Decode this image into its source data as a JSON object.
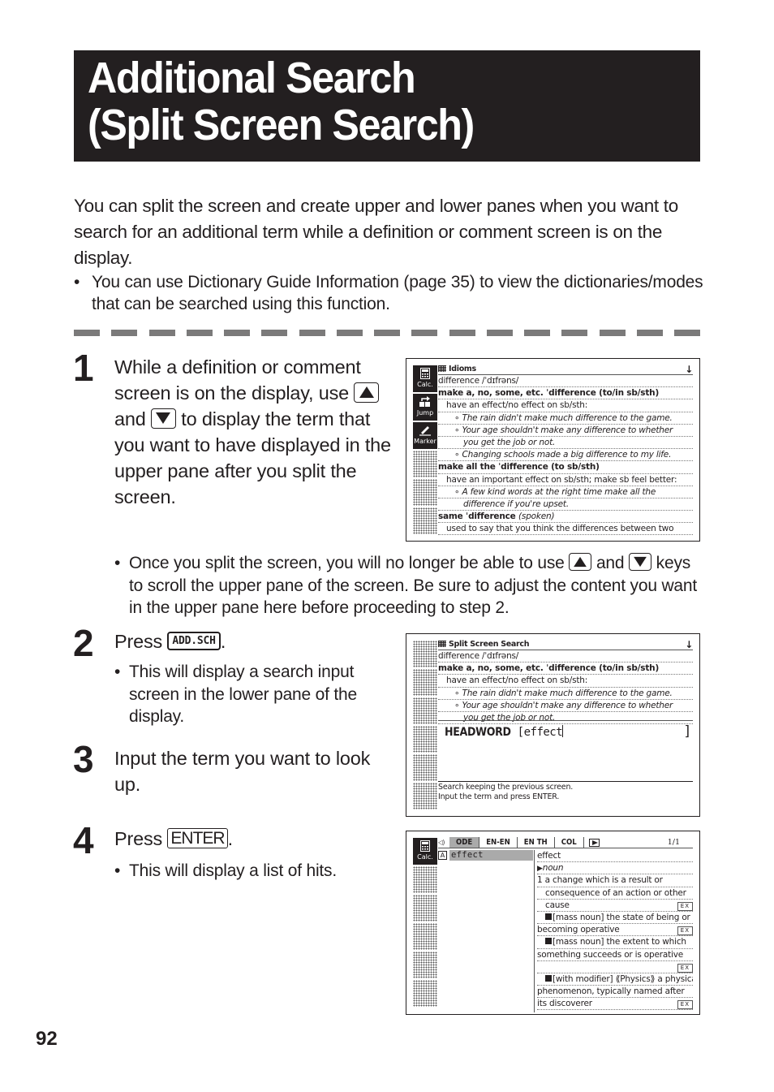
{
  "header": {
    "title_line1": "Additional Search",
    "title_line2": "(Split Screen Search)"
  },
  "intro": {
    "text": "You can split the screen and create upper and lower panes when you want to search for an additional term while a definition or comment screen is on the display.",
    "note": "You can use Dictionary Guide Information (page 35) to view the dictionaries/modes that can be searched using this function."
  },
  "steps": [
    {
      "number": "1",
      "text_part1": "While a definition or comment screen is on the display, use",
      "key_up": "up-arrow-key",
      "and": "and",
      "key_down": "down-arrow-key",
      "text_part2": "to display the term that you want to have displayed in the upper pane after you split the screen.",
      "note_part1": "Once you split the screen, you will no longer be able to use",
      "note_and": "and",
      "note_part2": "keys to scroll the upper pane of the screen. Be sure to adjust the content you want in the upper pane here before proceeding to step 2."
    },
    {
      "number": "2",
      "press": "Press",
      "key": "ADD.SCH",
      "note": "This will display a search input screen in the lower pane of the display."
    },
    {
      "number": "3",
      "text": "Input the term you want to look up."
    },
    {
      "number": "4",
      "press": "Press",
      "key": "ENTER",
      "note": "This will display a list of hits."
    }
  ],
  "screen1": {
    "title": "Idioms",
    "sidebar": [
      "Calc.",
      "Jump",
      "Marker"
    ],
    "rows": [
      {
        "style": "plain",
        "text": "difference /ˈdɪfrəns/"
      },
      {
        "style": "b",
        "text": "make a, no, some, etc. ˈdifference (to/in sb/sth)"
      },
      {
        "style": "i1",
        "text": "have an effect/no effect on sb/sth:"
      },
      {
        "style": "i2",
        "text": "∘ The rain didn't make much difference to the game."
      },
      {
        "style": "i2",
        "text": "∘ Your age shouldn't make any difference to whether"
      },
      {
        "style": "i3",
        "text": "you get the job or not."
      },
      {
        "style": "i2",
        "text": "∘ Changing schools made a big difference to my life."
      },
      {
        "style": "b",
        "text": "make all the ˈdifference (to sb/sth)"
      },
      {
        "style": "i1",
        "text": "have an important effect on sb/sth; make sb feel better:"
      },
      {
        "style": "i2",
        "text": "∘ A few kind words at the right time make all the"
      },
      {
        "style": "i3",
        "text": "difference if you're upset."
      },
      {
        "style": "b",
        "text": "same ˈdifference",
        "suffix": "(spoken)"
      },
      {
        "style": "i1",
        "text": "used to say that you think the differences between two"
      }
    ]
  },
  "screen2": {
    "title": "Split Screen Search",
    "rows": [
      {
        "style": "plain",
        "text": "difference /ˈdɪfrəns/"
      },
      {
        "style": "b",
        "text": "make a, no, some, etc. ˈdifference (to/in sb/sth)"
      },
      {
        "style": "i1",
        "text": "have an effect/no effect on sb/sth:"
      },
      {
        "style": "i2",
        "text": "∘ The rain didn't make much difference to the game."
      },
      {
        "style": "i2",
        "text": "∘ Your age shouldn't make any difference to whether"
      },
      {
        "style": "i3",
        "text": "you get the job or not."
      }
    ],
    "input_label": "HEADWORD",
    "input_value": "effect",
    "guide_line1": "Search keeping the previous screen.",
    "guide_line2": "Input the term and press ENTER."
  },
  "screen3": {
    "sidebar": [
      "Calc."
    ],
    "tabs": [
      {
        "label": "ODE",
        "active": true
      },
      {
        "label": "EN-EN",
        "active": false
      },
      {
        "label": "EN TH",
        "active": false
      },
      {
        "label": "COL",
        "active": false
      }
    ],
    "page_indicator": "1/1",
    "hit_marker": "A",
    "hits": [
      "effect"
    ],
    "definition": [
      {
        "text": "effect"
      },
      {
        "text": "noun",
        "pos": true
      },
      {
        "text": "1 a change which is a result or"
      },
      {
        "text": "consequence of an action or other",
        "indent": true
      },
      {
        "text": "cause",
        "indent": true,
        "ex": "EX"
      },
      {
        "text": "[mass noun] the state of being or",
        "indent": true,
        "square": true
      },
      {
        "text": "becoming operative",
        "ex": "EX"
      },
      {
        "text": "[mass noun] the extent to which",
        "indent": true,
        "square": true
      },
      {
        "text": "something succeeds or is operative"
      },
      {
        "text": "",
        "ex": "EX"
      },
      {
        "text": "[with modifier] ⟪Physics⟫ a physical",
        "indent": true,
        "square": true
      },
      {
        "text": "phenomenon, typically named after"
      },
      {
        "text": "its discoverer",
        "ex": "EX"
      }
    ]
  },
  "page_number": "92"
}
